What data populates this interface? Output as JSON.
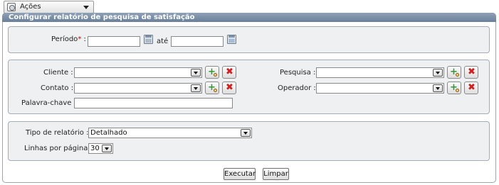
{
  "toolbar": {
    "acoes_label": "Ações"
  },
  "panel": {
    "title": "Configurar relatório de pesquisa de satisfação"
  },
  "periodo": {
    "label": "Período",
    "required_mark": "*",
    "colon": ":",
    "ate_label": "até",
    "start_value": "",
    "end_value": ""
  },
  "filters": {
    "cliente_label": "Cliente :",
    "contato_label": "Contato :",
    "palavra_chave_label": "Palavra-chave :",
    "pesquisa_label": "Pesquisa :",
    "operador_label": "Operador :",
    "cliente_value": "",
    "contato_value": "",
    "pesquisa_value": "",
    "operador_value": "",
    "palavra_chave_value": ""
  },
  "report": {
    "tipo_label": "Tipo de relatório :",
    "tipo_value": "Detalhado",
    "linhas_label": "Linhas por página :",
    "linhas_value": "30"
  },
  "actions": {
    "executar_label": "Executar",
    "limpar_label": "Limpar"
  },
  "icons": {
    "calendar": "calendar-icon",
    "add": "add-search-icon",
    "remove": "remove-x-icon",
    "actions": "gear-icon"
  },
  "colors": {
    "header_bar": "#7a8ea8",
    "section_bg": "#eef0f2",
    "required": "#d40000",
    "add_green": "#2f9a2f",
    "remove_red": "#d21e1e"
  }
}
